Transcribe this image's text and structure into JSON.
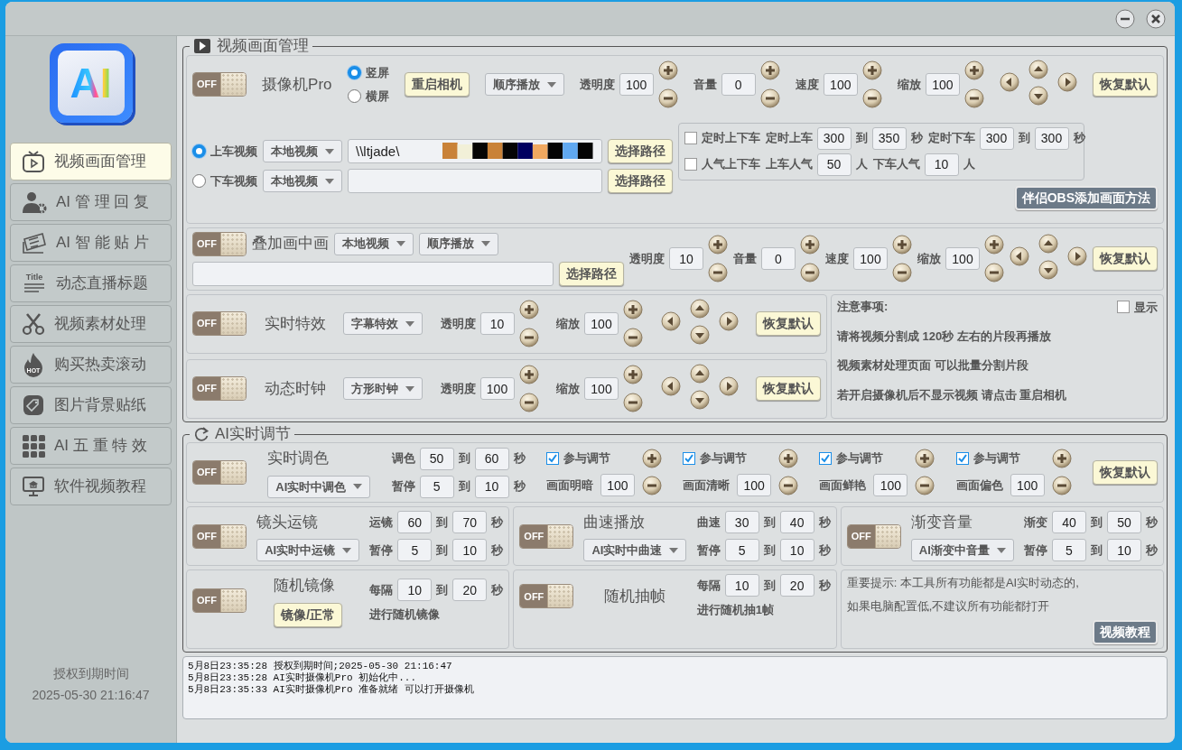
{
  "sidebar": {
    "logo": "AI",
    "items": [
      {
        "label": "视频画面管理",
        "selected": true
      },
      {
        "label": "AI 管 理 回 复",
        "selected": false
      },
      {
        "label": "AI 智 能 贴 片",
        "selected": false
      },
      {
        "label": "动态直播标题",
        "icon_text": "Title",
        "selected": false
      },
      {
        "label": "视频素材处理",
        "selected": false
      },
      {
        "label": "购买热卖滚动",
        "icon_text": "HOT",
        "selected": false
      },
      {
        "label": "图片背景贴纸",
        "selected": false
      },
      {
        "label": "AI 五 重 特 效",
        "selected": false
      },
      {
        "label": "软件视频教程",
        "selected": false
      }
    ],
    "license_label": "授权到期时间",
    "license_date": "2025-05-30 21:16:47"
  },
  "sections": [
    {
      "title": "视频画面管理",
      "panel_rows": [
        [
          {
            "lines": [
              [
                {
                  "kind": "toggle",
                  "label": "OFF",
                  "on": false
                },
                {
                  "kind": "title",
                  "text": "摄像机Pro"
                },
                {
                  "kind": "column",
                  "lines": [
                    [
                      {
                        "kind": "radio",
                        "label": "竖屏",
                        "selected": true
                      }
                    ],
                    [
                      {
                        "kind": "radio",
                        "label": "横屏",
                        "selected": false
                      }
                    ]
                  ]
                },
                {
                  "kind": "button",
                  "label": "重启相机"
                },
                {
                  "kind": "dropdown",
                  "value": "顺序播放"
                },
                {
                  "kind": "stepper",
                  "label": "透明度",
                  "value": "100"
                },
                {
                  "kind": "stepper",
                  "label": "音量",
                  "value": "0"
                },
                {
                  "kind": "stepper",
                  "label": "速度",
                  "value": "100"
                },
                {
                  "kind": "stepper",
                  "label": "缩放",
                  "value": "100"
                },
                {
                  "kind": "dpad"
                },
                {
                  "kind": "button",
                  "label": "恢复默认"
                }
              ],
              [
                {
                  "kind": "column",
                  "lines": [
                    [
                      {
                        "kind": "radio",
                        "label": "上车视频",
                        "selected": true
                      },
                      {
                        "kind": "dropdown",
                        "value": "本地视频"
                      },
                      {
                        "kind": "field",
                        "value": "\\\\ltjade\\",
                        "redacted": true
                      },
                      {
                        "kind": "button",
                        "label": "选择路径"
                      }
                    ],
                    [
                      {
                        "kind": "radio",
                        "label": "下车视频",
                        "selected": false
                      },
                      {
                        "kind": "dropdown",
                        "value": "本地视频"
                      },
                      {
                        "kind": "field"
                      },
                      {
                        "kind": "button",
                        "label": "选择路径"
                      }
                    ]
                  ]
                },
                {
                  "kind": "column",
                  "lines": [
                    [
                      {
                        "kind": "box",
                        "lines": [
                          [
                            {
                              "kind": "checkbox",
                              "label": "定时上下车",
                              "checked": false
                            },
                            {
                              "kind": "range",
                              "label": "定时上车",
                              "from": "300",
                              "sep": "到",
                              "to": "350",
                              "unit": "秒"
                            },
                            {
                              "kind": "range",
                              "label": "定时下车",
                              "from": "300",
                              "sep": "到",
                              "to": "300",
                              "unit": "秒"
                            }
                          ],
                          [
                            {
                              "kind": "checkbox",
                              "label": "人气上下车",
                              "checked": false
                            },
                            {
                              "kind": "count",
                              "label": "上车人气",
                              "value": "50",
                              "unit": "人"
                            },
                            {
                              "kind": "count",
                              "label": "下车人气",
                              "value": "10",
                              "unit": "人"
                            }
                          ]
                        ]
                      }
                    ],
                    [
                      {
                        "kind": "dark_button",
                        "label": "伴侣OBS添加画面方法"
                      }
                    ]
                  ]
                }
              ]
            ]
          }
        ],
        [
          {
            "lines": [
              [
                {
                  "kind": "column",
                  "lines": [
                    [
                      {
                        "kind": "toggle",
                        "label": "OFF",
                        "on": false
                      },
                      {
                        "kind": "title",
                        "text": "叠加画中画"
                      },
                      {
                        "kind": "dropdown",
                        "value": "本地视频"
                      },
                      {
                        "kind": "dropdown",
                        "value": "顺序播放"
                      }
                    ],
                    [
                      {
                        "kind": "field"
                      },
                      {
                        "kind": "button",
                        "label": "选择路径"
                      }
                    ]
                  ]
                },
                {
                  "kind": "stepper",
                  "label": "透明度",
                  "value": "10"
                },
                {
                  "kind": "stepper",
                  "label": "音量",
                  "value": "0"
                },
                {
                  "kind": "stepper",
                  "label": "速度",
                  "value": "100"
                },
                {
                  "kind": "stepper",
                  "label": "缩放",
                  "value": "100"
                },
                {
                  "kind": "dpad"
                },
                {
                  "kind": "button",
                  "label": "恢复默认"
                }
              ]
            ]
          }
        ],
        [
          {
            "panels": [
              {
                "lines": [
                  [
                    {
                      "kind": "toggle",
                      "label": "OFF",
                      "on": false
                    },
                    {
                      "kind": "title",
                      "text": "实时特效"
                    },
                    {
                      "kind": "dropdown",
                      "value": "字幕特效"
                    },
                    {
                      "kind": "stepper",
                      "label": "透明度",
                      "value": "10"
                    },
                    {
                      "kind": "stepper",
                      "label": "缩放",
                      "value": "100"
                    },
                    {
                      "kind": "dpad"
                    },
                    {
                      "kind": "button",
                      "label": "恢复默认"
                    }
                  ]
                ]
              },
              {
                "lines": [
                  [
                    {
                      "kind": "toggle",
                      "label": "OFF",
                      "on": false
                    },
                    {
                      "kind": "title",
                      "text": "动态时钟"
                    },
                    {
                      "kind": "dropdown",
                      "value": "方形时钟"
                    },
                    {
                      "kind": "stepper",
                      "label": "透明度",
                      "value": "100"
                    },
                    {
                      "kind": "stepper",
                      "label": "缩放",
                      "value": "100"
                    },
                    {
                      "kind": "dpad"
                    },
                    {
                      "kind": "button",
                      "label": "恢复默认"
                    }
                  ]
                ]
              }
            ]
          },
          {
            "lines": [
              [
                {
                  "kind": "note",
                  "text": "注意事项:"
                },
                {
                  "kind": "checkbox",
                  "label": "显示",
                  "checked": false
                }
              ],
              [
                {
                  "kind": "note",
                  "text": "请将视频分割成 120秒 左右的片段再播放"
                }
              ],
              [
                {
                  "kind": "note",
                  "text": "视频素材处理页面 可以批量分割片段"
                }
              ],
              [
                {
                  "kind": "note",
                  "text": "若开启摄像机后不显示视频 请点击 重启相机"
                }
              ]
            ]
          }
        ]
      ]
    },
    {
      "title": "AI实时调节",
      "panel_rows": [
        [
          {
            "lines": [
              [
                {
                  "kind": "toggle",
                  "label": "OFF",
                  "on": false
                },
                {
                  "kind": "column",
                  "lines": [
                    [
                      {
                        "kind": "title",
                        "text": "实时调色"
                      }
                    ],
                    [
                      {
                        "kind": "dropdown",
                        "value": "AI实时中调色"
                      }
                    ]
                  ]
                },
                {
                  "kind": "column",
                  "lines": [
                    [
                      {
                        "kind": "range",
                        "label": "调色",
                        "from": "50",
                        "sep": "到",
                        "to": "60",
                        "unit": "秒"
                      }
                    ],
                    [
                      {
                        "kind": "range",
                        "label": "暂停",
                        "from": "5",
                        "sep": "到",
                        "to": "10",
                        "unit": "秒"
                      }
                    ]
                  ]
                },
                {
                  "kind": "adjust",
                  "check_label": "参与调节",
                  "checked": true,
                  "label": "画面明暗",
                  "value": "100"
                },
                {
                  "kind": "adjust",
                  "check_label": "参与调节",
                  "checked": true,
                  "label": "画面清晰",
                  "value": "100"
                },
                {
                  "kind": "adjust",
                  "check_label": "参与调节",
                  "checked": true,
                  "label": "画面鲜艳",
                  "value": "100"
                },
                {
                  "kind": "adjust",
                  "check_label": "参与调节",
                  "checked": true,
                  "label": "画面偏色",
                  "value": "100"
                },
                {
                  "kind": "button",
                  "label": "恢复默认"
                }
              ]
            ]
          }
        ],
        [
          {
            "lines": [
              [
                {
                  "kind": "toggle",
                  "label": "OFF",
                  "on": false
                },
                {
                  "kind": "column",
                  "lines": [
                    [
                      {
                        "kind": "title",
                        "text": "镜头运镜"
                      }
                    ],
                    [
                      {
                        "kind": "dropdown",
                        "value": "AI实时中运镜"
                      }
                    ]
                  ]
                },
                {
                  "kind": "column",
                  "lines": [
                    [
                      {
                        "kind": "range",
                        "label": "运镜",
                        "from": "60",
                        "sep": "到",
                        "to": "70",
                        "unit": "秒"
                      }
                    ],
                    [
                      {
                        "kind": "range",
                        "label": "暂停",
                        "from": "5",
                        "sep": "到",
                        "to": "10",
                        "unit": "秒"
                      }
                    ]
                  ]
                }
              ]
            ]
          },
          {
            "lines": [
              [
                {
                  "kind": "toggle",
                  "label": "OFF",
                  "on": false
                },
                {
                  "kind": "column",
                  "lines": [
                    [
                      {
                        "kind": "title",
                        "text": "曲速播放"
                      }
                    ],
                    [
                      {
                        "kind": "dropdown",
                        "value": "AI实时中曲速"
                      }
                    ]
                  ]
                },
                {
                  "kind": "column",
                  "lines": [
                    [
                      {
                        "kind": "range",
                        "label": "曲速",
                        "from": "30",
                        "sep": "到",
                        "to": "40",
                        "unit": "秒"
                      }
                    ],
                    [
                      {
                        "kind": "range",
                        "label": "暂停",
                        "from": "5",
                        "sep": "到",
                        "to": "10",
                        "unit": "秒"
                      }
                    ]
                  ]
                }
              ]
            ]
          },
          {
            "lines": [
              [
                {
                  "kind": "toggle",
                  "label": "OFF",
                  "on": false
                },
                {
                  "kind": "column",
                  "lines": [
                    [
                      {
                        "kind": "title",
                        "text": "渐变音量"
                      }
                    ],
                    [
                      {
                        "kind": "dropdown",
                        "value": "AI渐变中音量"
                      }
                    ]
                  ]
                },
                {
                  "kind": "column",
                  "lines": [
                    [
                      {
                        "kind": "range",
                        "label": "渐变",
                        "from": "40",
                        "sep": "到",
                        "to": "50",
                        "unit": "秒"
                      }
                    ],
                    [
                      {
                        "kind": "range",
                        "label": "暂停",
                        "from": "5",
                        "sep": "到",
                        "to": "10",
                        "unit": "秒"
                      }
                    ]
                  ]
                }
              ]
            ]
          }
        ],
        [
          {
            "lines": [
              [
                {
                  "kind": "toggle",
                  "label": "OFF",
                  "on": false
                },
                {
                  "kind": "column",
                  "lines": [
                    [
                      {
                        "kind": "title",
                        "text": "随机镜像"
                      }
                    ],
                    [
                      {
                        "kind": "button",
                        "label": "镜像/正常"
                      }
                    ]
                  ]
                },
                {
                  "kind": "column",
                  "lines": [
                    [
                      {
                        "kind": "range",
                        "label": "每隔",
                        "from": "10",
                        "sep": "到",
                        "to": "20",
                        "unit": "秒"
                      }
                    ],
                    [
                      {
                        "kind": "text",
                        "text": "进行随机镜像"
                      }
                    ]
                  ]
                }
              ]
            ]
          },
          {
            "lines": [
              [
                {
                  "kind": "toggle",
                  "label": "OFF",
                  "on": false
                },
                {
                  "kind": "column",
                  "lines": [
                    [
                      {
                        "kind": "title",
                        "text": "随机抽帧"
                      }
                    ]
                  ]
                },
                {
                  "kind": "column",
                  "lines": [
                    [
                      {
                        "kind": "range",
                        "label": "每隔",
                        "from": "10",
                        "sep": "到",
                        "to": "20",
                        "unit": "秒"
                      }
                    ],
                    [
                      {
                        "kind": "text",
                        "text": "进行随机抽1帧"
                      }
                    ]
                  ]
                }
              ]
            ]
          },
          {
            "lines": [
              [
                {
                  "kind": "column",
                  "lines": [
                    [
                      {
                        "kind": "plain",
                        "text": "重要提示: 本工具所有功能都是AI实时动态的,"
                      }
                    ],
                    [
                      {
                        "kind": "plain",
                        "text": "如果电脑配置低,不建议所有功能都打开"
                      }
                    ],
                    [
                      {
                        "kind": "dark_button",
                        "label": "视频教程"
                      }
                    ]
                  ]
                }
              ]
            ]
          }
        ]
      ]
    }
  ],
  "log": {
    "lines": [
      "5月8日23:35:28 授权到期时间;2025-05-30 21:16:47",
      "5月8日23:35:28 AI实时摄像机Pro 初始化中...",
      "5月8日23:35:33 AI实时摄像机Pro 准备就绪 可以打开摄像机"
    ]
  }
}
